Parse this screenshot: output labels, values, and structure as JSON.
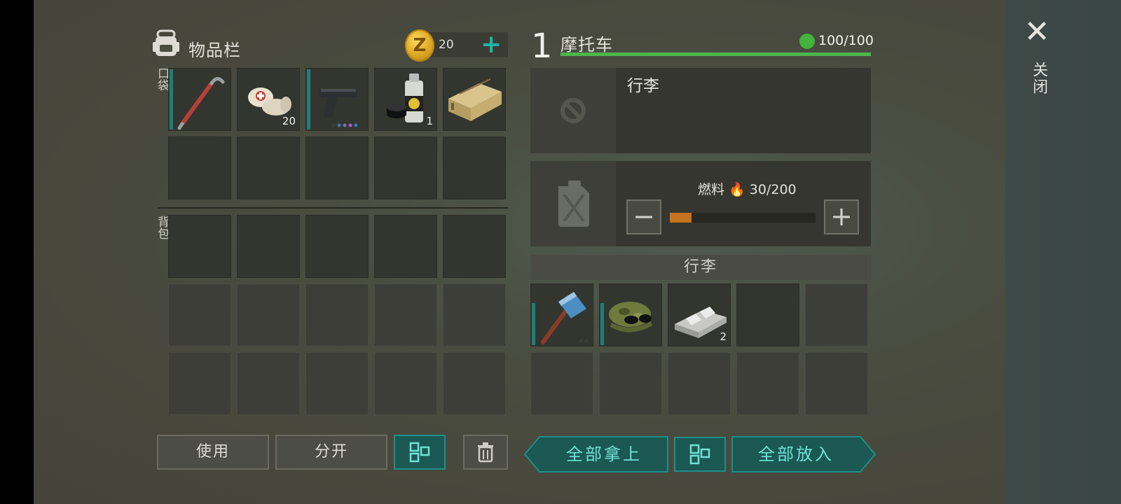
{
  "inventory": {
    "title": "物品栏",
    "currency_count": "20",
    "currency_plus": "+",
    "coin_glyph": "Z",
    "pocket_label": "口袋",
    "backpack_label": "背包",
    "pocket_items": [
      {
        "icon": "crowbar-icon",
        "count": ""
      },
      {
        "icon": "bandage-icon",
        "count": "20"
      },
      {
        "icon": "pistol-icon",
        "count": ""
      },
      {
        "icon": "spray-paint-icon",
        "count": "1"
      },
      {
        "icon": "wooden-crate-icon",
        "count": ""
      }
    ],
    "buttons": {
      "use": "使用",
      "split": "分开"
    }
  },
  "vehicle": {
    "number": "1",
    "name": "摩托车",
    "durability": "100/100",
    "luggage_title": "行李",
    "fuel_label": "燃料",
    "fuel_value": "30/200",
    "fuel_fraction": 0.15,
    "fuel_minus": "−",
    "fuel_plus": "+",
    "luggage_header": "行李",
    "luggage_items": [
      {
        "icon": "sledgehammer-icon",
        "count": ""
      },
      {
        "icon": "camo-cap-sunglasses-icon",
        "count": ""
      },
      {
        "icon": "metal-ingot-icon",
        "count": "2"
      }
    ],
    "take_all": "全部拿上",
    "put_all": "全部放入"
  },
  "close": {
    "glyph": "✕",
    "label": "关闭"
  },
  "colors": {
    "accent": "#1fb2a6",
    "health": "#4cb64a",
    "fuel": "#c6721e"
  }
}
